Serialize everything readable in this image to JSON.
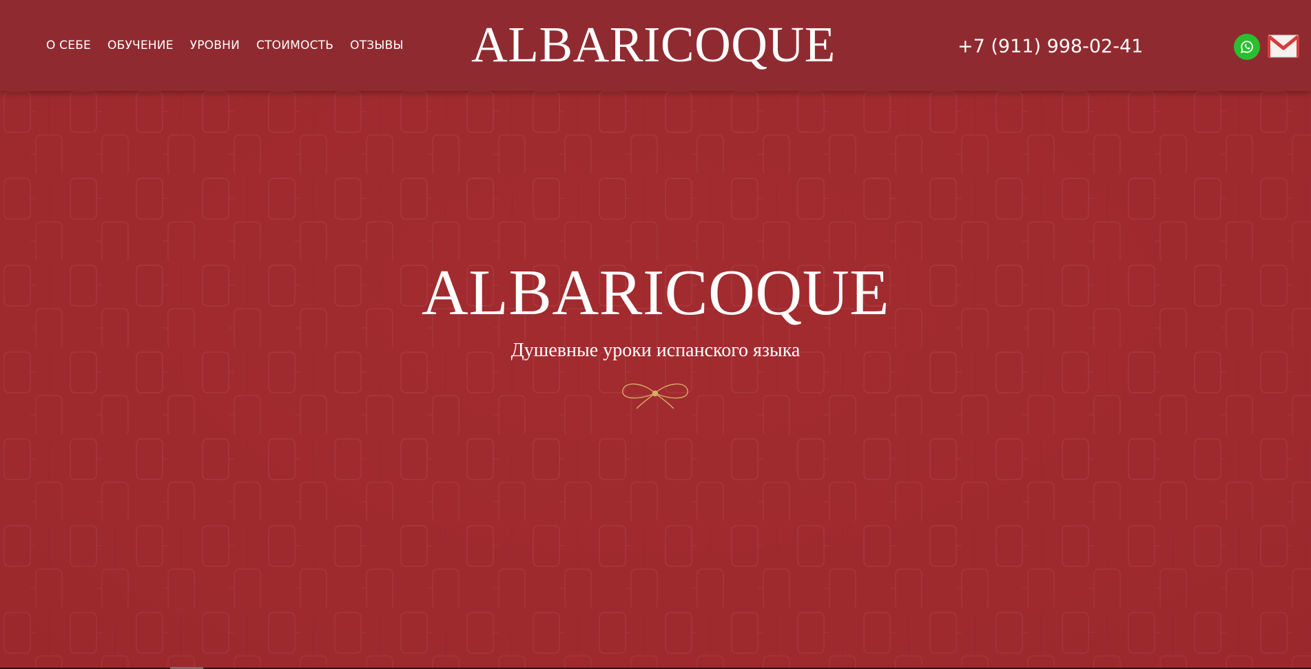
{
  "header": {
    "nav": [
      {
        "label": "О СЕБЕ"
      },
      {
        "label": "ОБУЧЕНИЕ"
      },
      {
        "label": "УРОВНИ"
      },
      {
        "label": "СТОИМОСТЬ"
      },
      {
        "label": "ОТЗЫВЫ"
      }
    ],
    "brand": "ALBARICOQUE",
    "phone": "+7 (911) 998-02-41",
    "icons": {
      "whatsapp": "whatsapp-icon",
      "mail": "mail-icon"
    }
  },
  "hero": {
    "title": "ALBARICOQUE",
    "subtitle": "Душевные уроки испанского языка"
  },
  "colors": {
    "header_bg": "#8f2b30",
    "hero_bg": "#a22c2f",
    "text": "#ffffff",
    "accent_gold": "#d4b06a",
    "whatsapp_green": "#29c02f",
    "mail_red": "#d53d3d"
  }
}
